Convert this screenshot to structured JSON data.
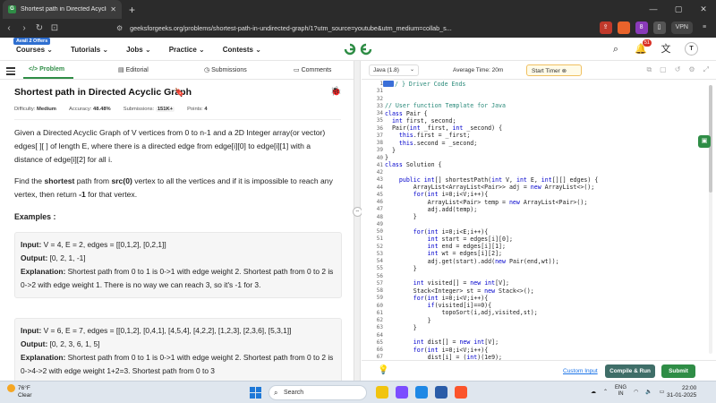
{
  "browser": {
    "tab_title": "Shortest path in Directed Acyclic",
    "url": "geeksforgeeks.org/problems/shortest-path-in-undirected-graph/1?utm_source=youtube&utm_medium=collab_s...",
    "vpn_label": "VPN",
    "brave_count": "8"
  },
  "header": {
    "badge": "Avail 2 Offers",
    "menu": [
      "Courses",
      "Tutorials",
      "Jobs",
      "Practice",
      "Contests"
    ],
    "logo": "GG",
    "notif_count": "51",
    "avatar": "T"
  },
  "problem_tabs": [
    "Problem",
    "Editorial",
    "Submissions",
    "Comments"
  ],
  "problem": {
    "title": "Shortest path in Directed Acyclic Graph",
    "difficulty_label": "Difficulty:",
    "difficulty": "Medium",
    "accuracy_label": "Accuracy:",
    "accuracy": "48.48%",
    "submissions_label": "Submissions:",
    "submissions": "151K+",
    "points_label": "Points:",
    "points": "4",
    "desc1": "Given a Directed Acyclic Graph of V vertices from 0 to n-1 and a 2D Integer array(or vector) edges[ ][ ] of length E, where there is a directed edge from edge[i][0] to edge[i][1] with a distance of edge[i][2] for all i.",
    "desc2_a": "Find the ",
    "desc2_b": "shortest",
    "desc2_c": " path from ",
    "desc2_d": "src(0)",
    "desc2_e": " vertex to all the vertices and if it is impossible to reach any vertex, then return ",
    "desc2_f": "-1",
    "desc2_g": " for that vertex.",
    "examples_heading": "Examples :",
    "examples": [
      {
        "input_label": "Input:",
        "input": "V = 4, E = 2, edges = [[0,1,2], [0,2,1]]",
        "output_label": "Output:",
        "output": "[0, 2, 1, -1]",
        "expl_label": "Explanation:",
        "expl": "Shortest path from 0 to 1 is 0->1 with edge weight 2. Shortest path from 0 to 2 is 0->2 with edge weight 1. There is no way we can reach 3, so it's -1 for 3."
      },
      {
        "input_label": "Input:",
        "input": "V = 6, E = 7, edges = [[0,1,2], [0,4,1], [4,5,4], [4,2,2], [1,2,3], [2,3,6], [5,3,1]]",
        "output_label": "Output:",
        "output": "[0, 2, 3, 6, 1, 5]",
        "expl_label": "Explanation:",
        "expl": "Shortest path from 0 to 1 is 0->1 with edge weight 2. Shortest path from 0 to 2 is 0->4->2 with edge weight 1+2=3. Shortest path from 0 to 3"
      }
    ]
  },
  "editor": {
    "language": "Java (1.8)",
    "avg_time": "Average Time: 20m",
    "timer": "Start Timer",
    "lines": [
      {
        "n": "1",
        "t": "/ } Driver Code Ends"
      },
      {
        "n": "31",
        "t": ""
      },
      {
        "n": "32",
        "t": ""
      },
      {
        "n": "33",
        "t": "// User function Template for Java"
      },
      {
        "n": "34",
        "t": "class Pair {"
      },
      {
        "n": "35",
        "t": "  int first, second;"
      },
      {
        "n": "36",
        "t": "  Pair(int _first, int _second) {"
      },
      {
        "n": "37",
        "t": "    this.first = _first;"
      },
      {
        "n": "38",
        "t": "    this.second = _second;"
      },
      {
        "n": "39",
        "t": "  }"
      },
      {
        "n": "40",
        "t": "}"
      },
      {
        "n": "41",
        "t": "class Solution {"
      },
      {
        "n": "42",
        "t": ""
      },
      {
        "n": "43",
        "t": "    public int[] shortestPath(int V, int E, int[][] edges) {"
      },
      {
        "n": "44",
        "t": "        ArrayList<ArrayList<Pair>> adj = new ArrayList<>();"
      },
      {
        "n": "45",
        "t": "        for(int i=0;i<V;i++){"
      },
      {
        "n": "46",
        "t": "            ArrayList<Pair> temp = new ArrayList<Pair>();"
      },
      {
        "n": "47",
        "t": "            adj.add(temp);"
      },
      {
        "n": "48",
        "t": "        }"
      },
      {
        "n": "49",
        "t": ""
      },
      {
        "n": "50",
        "t": "        for(int i=0;i<E;i++){"
      },
      {
        "n": "51",
        "t": "            int start = edges[i][0];"
      },
      {
        "n": "52",
        "t": "            int end = edges[i][1];"
      },
      {
        "n": "53",
        "t": "            int wt = edges[i][2];"
      },
      {
        "n": "54",
        "t": "            adj.get(start).add(new Pair(end,wt));"
      },
      {
        "n": "55",
        "t": "        }"
      },
      {
        "n": "56",
        "t": ""
      },
      {
        "n": "57",
        "t": "        int visited[] = new int[V];"
      },
      {
        "n": "58",
        "t": "        Stack<Integer> st = new Stack<>();"
      },
      {
        "n": "59",
        "t": "        for(int i=0;i<V;i++){"
      },
      {
        "n": "60",
        "t": "            if(visited[i]==0){"
      },
      {
        "n": "61",
        "t": "                topoSort(i,adj,visited,st);"
      },
      {
        "n": "62",
        "t": "            }"
      },
      {
        "n": "63",
        "t": "        }"
      },
      {
        "n": "64",
        "t": ""
      },
      {
        "n": "65",
        "t": "        int dist[] = new int[V];"
      },
      {
        "n": "66",
        "t": "        for(int i=0;i<V;i++){"
      },
      {
        "n": "67",
        "t": "            dist[i] = (int)(1e9);"
      }
    ],
    "custom_input": "Custom Input",
    "compile_run": "Compile & Run",
    "submit": "Submit"
  },
  "taskbar": {
    "temp": "76°F",
    "weather": "Clear",
    "search_placeholder": "Search",
    "lang": "ENG",
    "region": "IN",
    "time": "22:00",
    "date": "31-01-2025"
  },
  "colors": {
    "brand_green": "#2f8d46",
    "compile_teal": "#3f6e68",
    "keyword_blue": "#0000cc",
    "comment_teal": "#2a8a7a"
  }
}
